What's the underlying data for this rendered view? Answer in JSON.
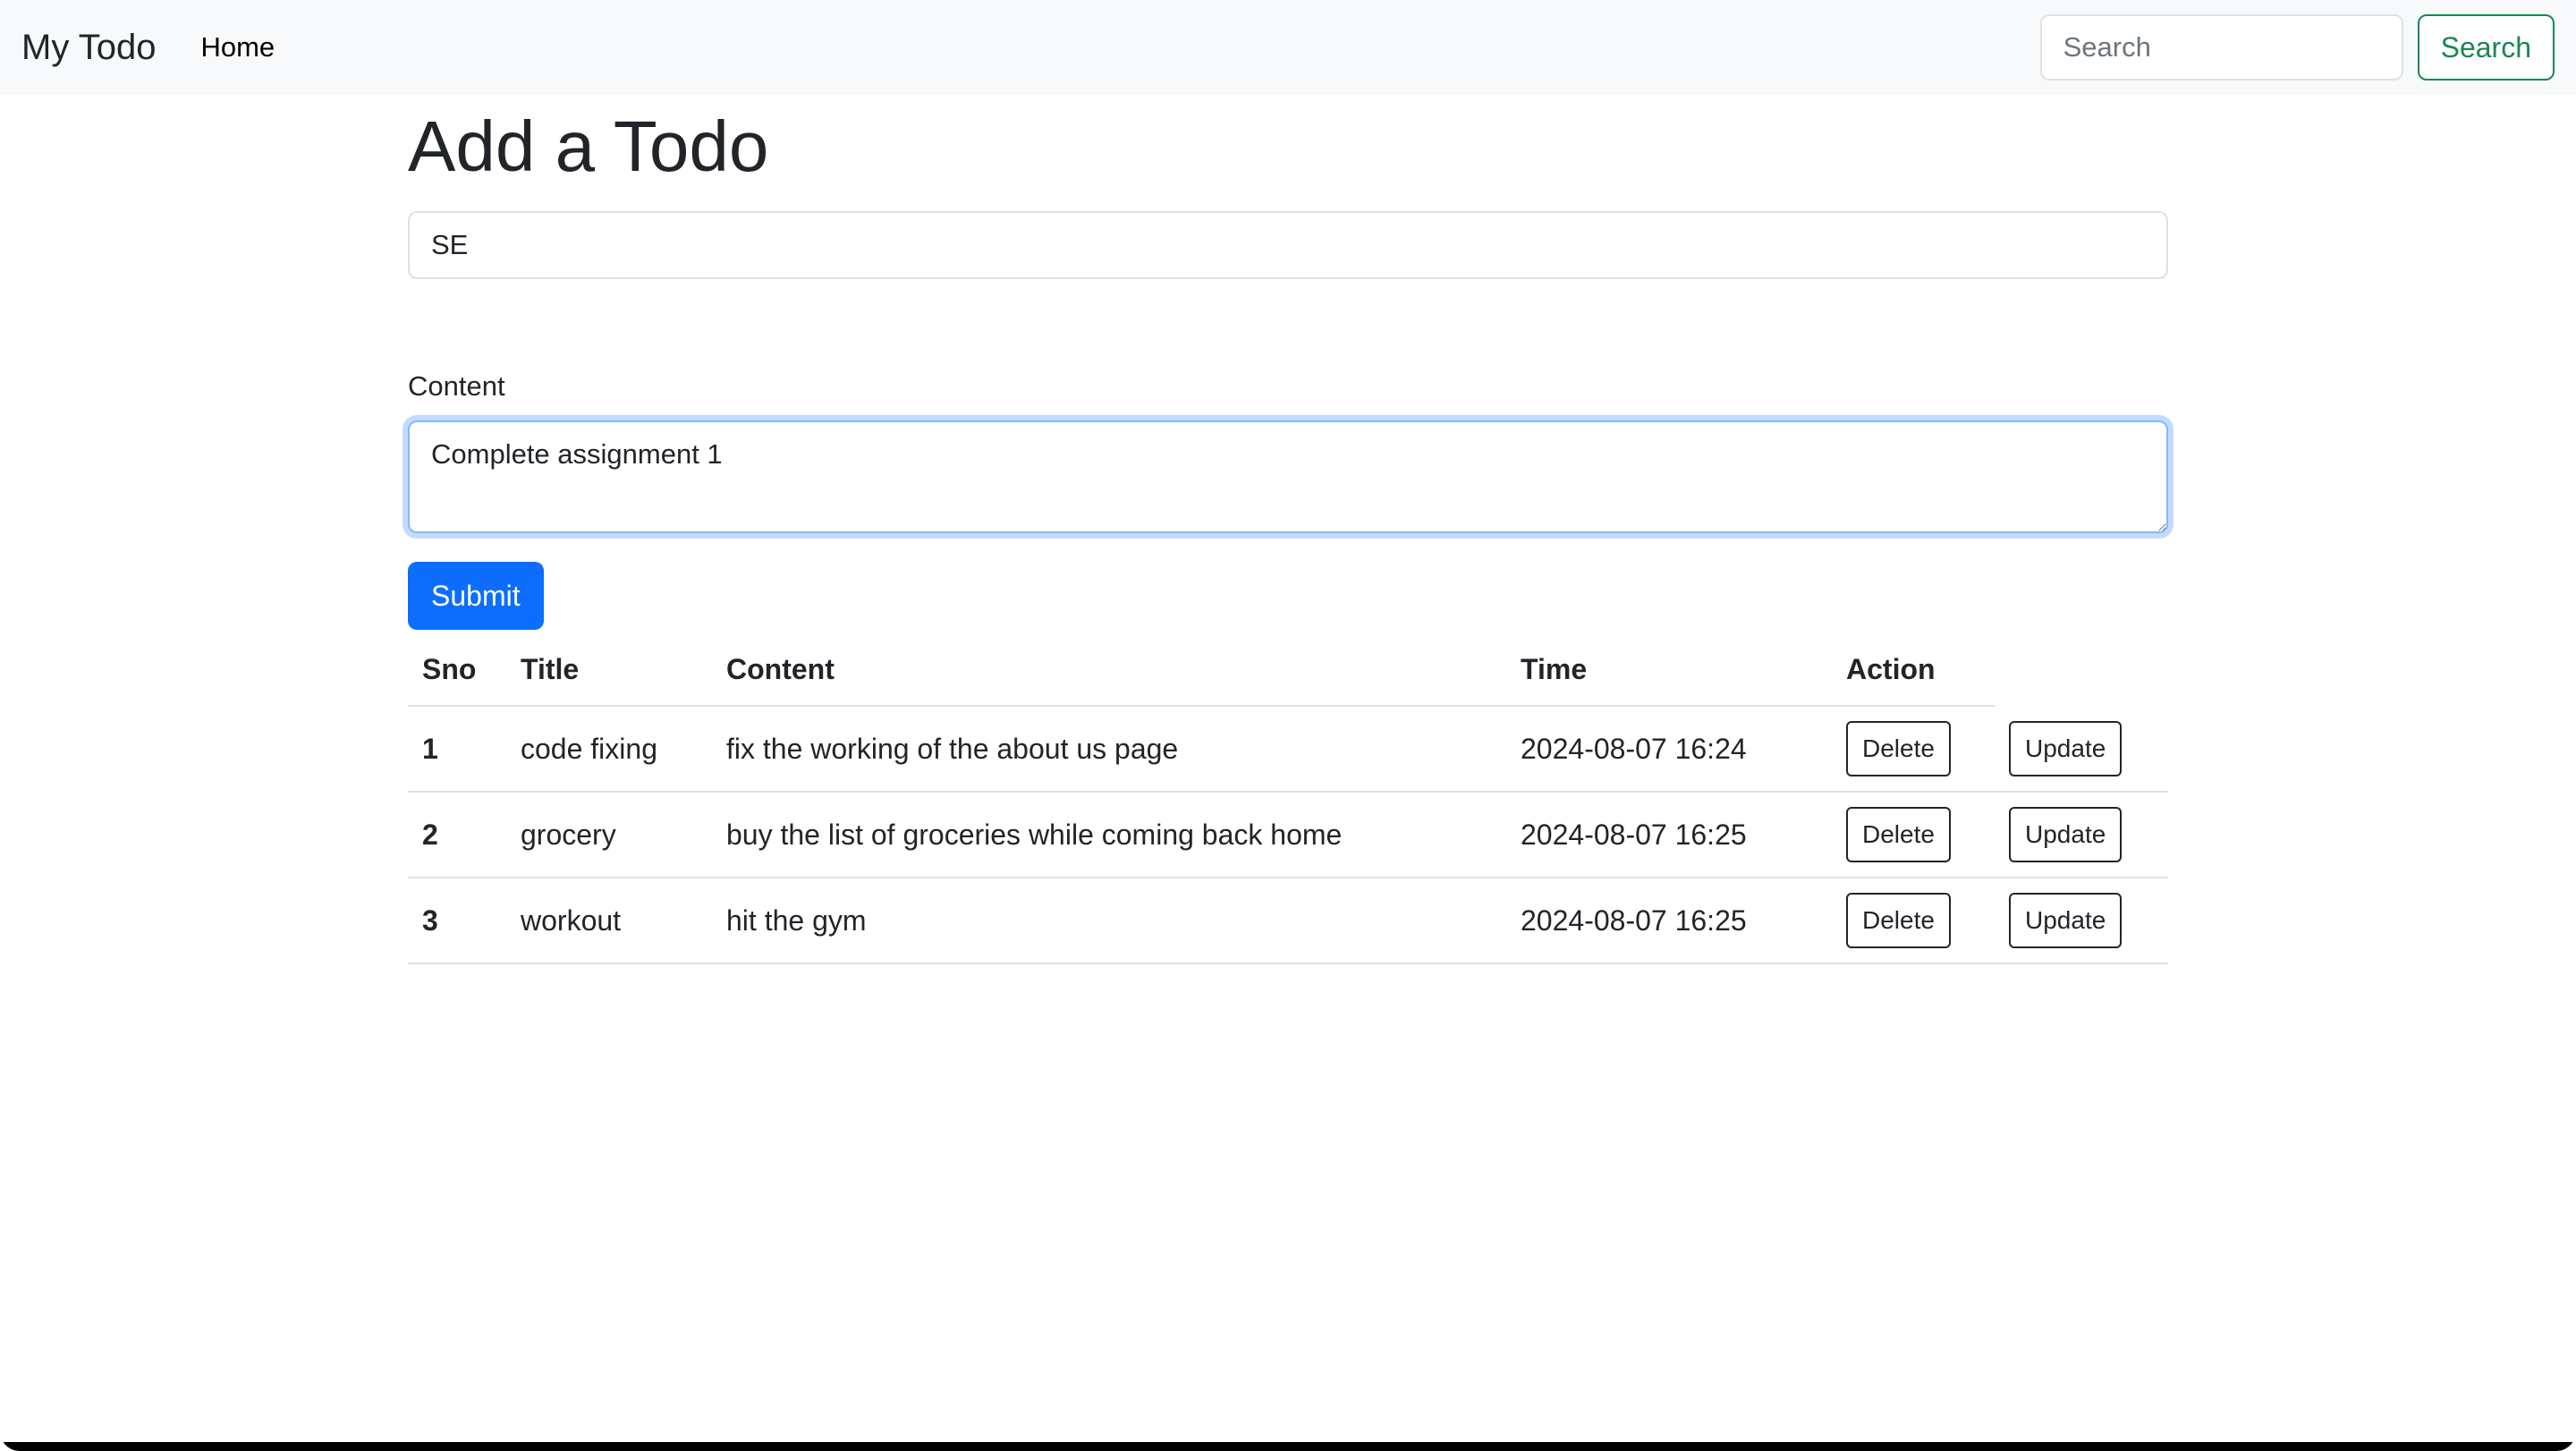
{
  "navbar": {
    "brand": "My Todo",
    "links": [
      "Home"
    ],
    "search_placeholder": "Search",
    "search_button": "Search"
  },
  "form": {
    "heading": "Add a Todo",
    "title_value": "SE",
    "content_label": "Content",
    "content_value": "Complete assignment 1",
    "submit_label": "Submit"
  },
  "table": {
    "headers": [
      "Sno",
      "Title",
      "Content",
      "Time",
      "Action"
    ],
    "rows": [
      {
        "sno": "1",
        "title": "code fixing",
        "content": "fix the working of the about us page",
        "time": "2024-08-07 16:24"
      },
      {
        "sno": "2",
        "title": "grocery",
        "content": "buy the list of groceries while coming back home",
        "time": "2024-08-07 16:25"
      },
      {
        "sno": "3",
        "title": "workout",
        "content": "hit the gym",
        "time": "2024-08-07 16:25"
      }
    ],
    "delete_label": "Delete",
    "update_label": "Update"
  },
  "colors": {
    "primary": "#0d6efd",
    "success": "#198754",
    "navbar_bg": "#f8f9fa",
    "focus_border": "#86b7fe"
  }
}
